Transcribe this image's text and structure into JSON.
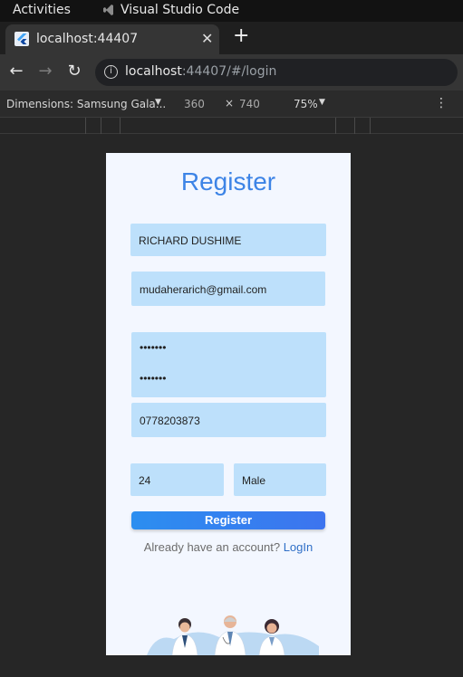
{
  "os_bar": {
    "activities": "Activities",
    "app_name": "Visual Studio Code"
  },
  "browser": {
    "tab_title": "localhost:44407",
    "url_host": "localhost",
    "url_rest": ":44407/#/login"
  },
  "devtools": {
    "dimensions_label": "Dimensions: Samsung Gala...",
    "width": "360",
    "times": "×",
    "height": "740",
    "zoom": "75%"
  },
  "form": {
    "heading": "Register",
    "full_name": "RICHARD DUSHIME",
    "email": "mudaherarich@gmail.com",
    "password": "•••••••",
    "confirm_password": "•••••••",
    "phone": "0778203873",
    "age": "24",
    "gender": "Male",
    "register_button": "Register",
    "already_text": "Already have an account?",
    "login_link": "LogIn"
  },
  "colors": {
    "accent": "#3d84e6",
    "field_bg": "#bde0fb",
    "page_bg": "#f3f7ff"
  }
}
